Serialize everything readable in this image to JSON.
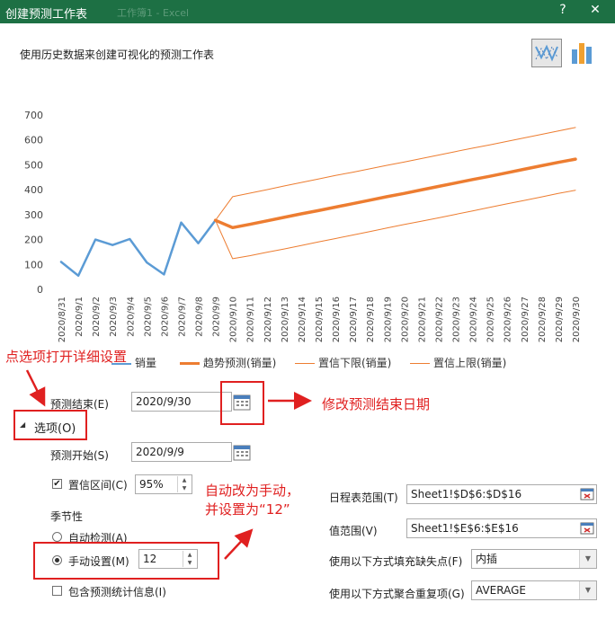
{
  "window": {
    "title": "创建预测工作表",
    "ghost_title": "工作簿1 - Excel",
    "help_label": "?",
    "close_label": "✕"
  },
  "subtitle": "使用历史数据来创建可视化的预测工作表",
  "view_buttons": [
    {
      "name": "line-chart-icon",
      "active": true
    },
    {
      "name": "bar-chart-icon",
      "active": false
    }
  ],
  "chart_data": {
    "type": "line",
    "x": [
      "2020/8/31",
      "2020/9/1",
      "2020/9/2",
      "2020/9/3",
      "2020/9/4",
      "2020/9/5",
      "2020/9/6",
      "2020/9/7",
      "2020/9/8",
      "2020/9/9",
      "2020/9/10",
      "2020/9/11",
      "2020/9/12",
      "2020/9/13",
      "2020/9/14",
      "2020/9/15",
      "2020/9/16",
      "2020/9/17",
      "2020/9/18",
      "2020/9/19",
      "2020/9/20",
      "2020/9/21",
      "2020/9/22",
      "2020/9/23",
      "2020/9/24",
      "2020/9/25",
      "2020/9/26",
      "2020/9/27",
      "2020/9/28",
      "2020/9/29",
      "2020/9/30"
    ],
    "ylim": [
      0,
      700
    ],
    "yticks": [
      0,
      100,
      200,
      300,
      400,
      500,
      600,
      700
    ],
    "series": [
      {
        "name": "销量",
        "color": "#5b9bd5",
        "width": 2.5,
        "start": 0,
        "values": [
          110,
          55,
          200,
          178,
          202,
          108,
          60,
          268,
          185,
          277
        ]
      },
      {
        "name": "趋势预测(销量)",
        "color": "#ed7d31",
        "width": 3.5,
        "start": 9,
        "values": [
          277,
          248,
          261,
          275,
          289,
          303,
          316,
          330,
          344,
          358,
          372,
          385,
          399,
          413,
          427,
          441,
          454,
          468,
          482,
          496,
          510,
          523
        ]
      },
      {
        "name": "置信下限(销量)",
        "color": "#ed7d31",
        "width": 1,
        "start": 9,
        "values": [
          277,
          123,
          135,
          149,
          162,
          176,
          190,
          204,
          218,
          232,
          246,
          260,
          273,
          287,
          301,
          315,
          329,
          343,
          357,
          371,
          385,
          398
        ]
      },
      {
        "name": "置信上限(销量)",
        "color": "#ed7d31",
        "width": 1,
        "start": 9,
        "values": [
          277,
          372,
          386,
          400,
          415,
          429,
          443,
          457,
          470,
          484,
          498,
          511,
          525,
          539,
          553,
          567,
          580,
          594,
          608,
          622,
          636,
          650
        ]
      }
    ],
    "legend": {
      "position": "bottom"
    }
  },
  "form": {
    "forecast_end_label": "预测结束(E)",
    "forecast_end_value": "2020/9/30",
    "options_label": "选项(O)",
    "forecast_start_label": "预测开始(S)",
    "forecast_start_value": "2020/9/9",
    "confidence_label": "置信区间(C)",
    "confidence_value": "95%",
    "confidence_checked": true,
    "seasonality_label": "季节性",
    "auto_detect_label": "自动检测(A)",
    "manual_label": "手动设置(M)",
    "manual_value": "12",
    "include_stats_label": "包含预测统计信息(I)",
    "timeline_label": "日程表范围(T)",
    "timeline_value": "Sheet1!$D$6:$D$16",
    "values_label": "值范围(V)",
    "values_value": "Sheet1!$E$6:$E$16",
    "fill_missing_label": "使用以下方式填充缺失点(F)",
    "fill_missing_value": "内插",
    "aggregate_label": "使用以下方式聚合重复项(G)",
    "aggregate_value": "AVERAGE"
  },
  "annotations": {
    "options_tip": "点选项打开详细设置",
    "end_date_tip": "修改预测结束日期",
    "manual_tip_line1": "自动改为手动，",
    "manual_tip_line2": "并设置为“12”",
    "color": "#e02020"
  }
}
